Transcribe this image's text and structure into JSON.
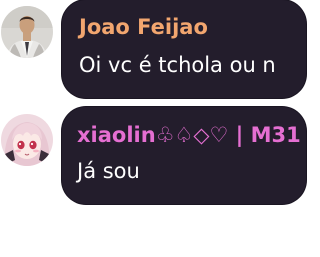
{
  "messages": [
    {
      "username": "Joao Feijao",
      "text": "Oi vc é tchola ou n",
      "username_color": "#f2a66f",
      "avatar_icon": "user-photo-avatar"
    },
    {
      "username": "xiaolin♧♤◇♡ | M31",
      "text": "Já sou",
      "username_color": "#e56fd2",
      "avatar_icon": "anime-girl-avatar"
    }
  ],
  "colors": {
    "bubble_bg": "#231d2c",
    "message_text": "#ffffff",
    "page_bg": "#ffffff"
  }
}
